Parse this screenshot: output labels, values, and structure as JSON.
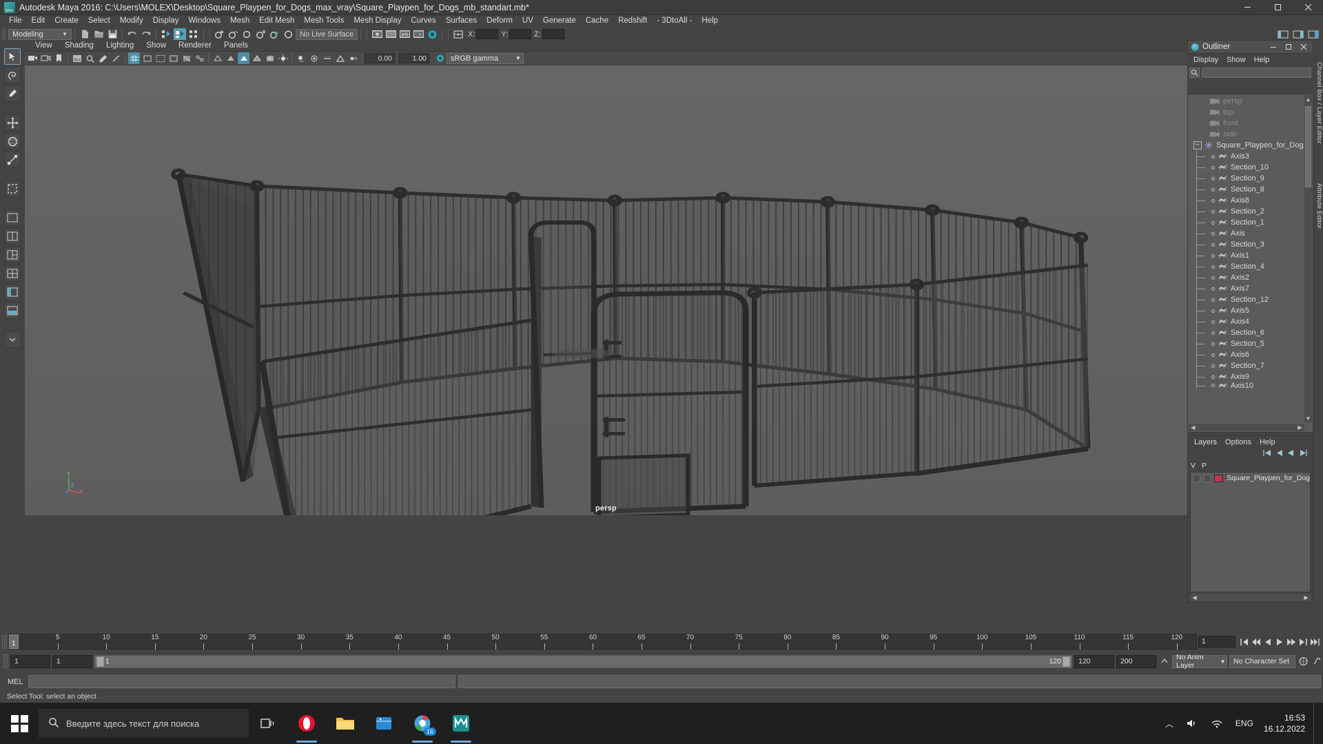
{
  "window": {
    "title": "Autodesk Maya 2016: C:\\Users\\MOLEX\\Desktop\\Square_Playpen_for_Dogs_max_vray\\Square_Playpen_for_Dogs_mb_standart.mb*",
    "minimize": "—",
    "maximize": "▢",
    "close": "✕"
  },
  "menubar": {
    "items": [
      {
        "label": "File"
      },
      {
        "label": "Edit"
      },
      {
        "label": "Create"
      },
      {
        "label": "Select"
      },
      {
        "label": "Modify"
      },
      {
        "label": "Display"
      },
      {
        "label": "Windows"
      },
      {
        "label": "Mesh"
      },
      {
        "label": "Edit Mesh"
      },
      {
        "label": "Mesh Tools"
      },
      {
        "label": "Mesh Display"
      },
      {
        "label": "Curves"
      },
      {
        "label": "Surfaces"
      },
      {
        "label": "Deform"
      },
      {
        "label": "UV"
      },
      {
        "label": "Generate"
      },
      {
        "label": "Cache"
      },
      {
        "label": "Redshift"
      },
      {
        "label": "- 3DtoAll -"
      },
      {
        "label": "Help"
      }
    ]
  },
  "statusline": {
    "menuset": "Modeling",
    "menuset_arrow": "▼",
    "live_surface": "No Live Surface",
    "coord_x_label": "X:",
    "coord_y_label": "Y:",
    "coord_z_label": "Z:",
    "coord_x_value": "",
    "coord_y_value": "",
    "coord_z_value": ""
  },
  "viewport_menu": {
    "items": [
      {
        "label": "View"
      },
      {
        "label": "Shading"
      },
      {
        "label": "Lighting"
      },
      {
        "label": "Show"
      },
      {
        "label": "Renderer"
      },
      {
        "label": "Panels"
      }
    ]
  },
  "viewport_toolbar": {
    "exposure_value": "0.00",
    "gamma_value": "1.00",
    "color_profile": "sRGB gamma",
    "color_profile_arrow": "▼"
  },
  "viewport": {
    "camera_label": "persp",
    "axis_y": "Y",
    "axis_x": "X",
    "axis_z": "Z"
  },
  "outliner": {
    "title": "Outliner",
    "menu": [
      {
        "label": "Display"
      },
      {
        "label": "Show"
      },
      {
        "label": "Help"
      }
    ],
    "win_minimize": "—",
    "win_maximize": "▢",
    "win_close": "✕",
    "search_placeholder": "",
    "root": {
      "label": "Square_Playpen_for_Dogs_n",
      "expand": "−"
    },
    "cameras": [
      {
        "label": "persp"
      },
      {
        "label": "top"
      },
      {
        "label": "front"
      },
      {
        "label": "side"
      }
    ],
    "children": [
      {
        "label": "Axis3"
      },
      {
        "label": "Section_10"
      },
      {
        "label": "Section_9"
      },
      {
        "label": "Section_8"
      },
      {
        "label": "Axis8"
      },
      {
        "label": "Section_2"
      },
      {
        "label": "Section_1"
      },
      {
        "label": "Axis"
      },
      {
        "label": "Section_3"
      },
      {
        "label": "Axis1"
      },
      {
        "label": "Section_4"
      },
      {
        "label": "Axis2"
      },
      {
        "label": "Axis7"
      },
      {
        "label": "Section_12"
      },
      {
        "label": "Axis5"
      },
      {
        "label": "Axis4"
      },
      {
        "label": "Section_6"
      },
      {
        "label": "Section_5"
      },
      {
        "label": "Axis6"
      },
      {
        "label": "Section_7"
      },
      {
        "label": "Axis9"
      },
      {
        "label": "Axis10"
      }
    ],
    "scroll_up": "▲",
    "scroll_down": "▼",
    "scroll_left": "◀",
    "scroll_right": "▶"
  },
  "layers": {
    "menu": [
      {
        "label": "Layers"
      },
      {
        "label": "Options"
      },
      {
        "label": "Help"
      }
    ],
    "columns": [
      "V",
      "P"
    ],
    "rows": [
      {
        "visible": "",
        "playback": "",
        "color": "#c4344f",
        "name": "Square_Playpen_for_Dog"
      }
    ],
    "scroll_left": "◀",
    "scroll_right": "▶"
  },
  "right_tabs": [
    {
      "label": "Channel Box / Layer Editor"
    },
    {
      "label": "Attribute Editor"
    }
  ],
  "timeline": {
    "current_frame": "1",
    "ticks": [
      5,
      10,
      15,
      20,
      25,
      30,
      35,
      40,
      45,
      50,
      55,
      60,
      65,
      70,
      75,
      80,
      85,
      90,
      95,
      100,
      105,
      110,
      115,
      120
    ],
    "frame_field": "1",
    "controls": [
      "⏮",
      "⏪",
      "◀",
      "▶",
      "⏩",
      "⏭",
      "⏭|"
    ]
  },
  "range": {
    "start_field": "1",
    "end_field": "1",
    "slider_start_label": "1",
    "slider_end_label": "120",
    "playback_end": "120",
    "range_end": "200",
    "anim_layer": "No Anim Layer",
    "anim_layer_arrow": "▼",
    "character_set": "No Character Set"
  },
  "command_line": {
    "label": "MEL",
    "input_value": "",
    "output_value": ""
  },
  "help_line": {
    "text": "Select Tool: select an object"
  },
  "taskbar": {
    "search_placeholder": "Введите здесь текст для поиска",
    "language": "ENG",
    "time": "16:53",
    "date": "16.12.2022",
    "tray_up": "︿"
  }
}
